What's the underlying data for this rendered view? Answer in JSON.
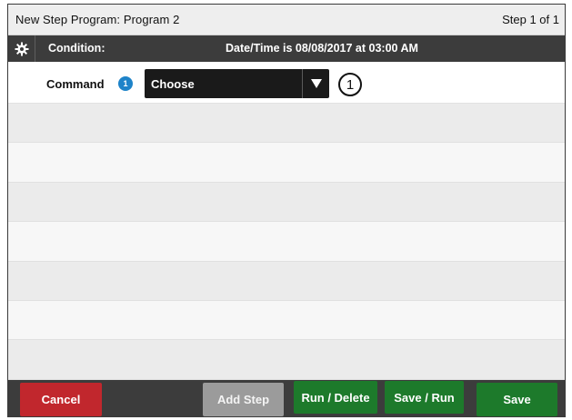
{
  "header": {
    "title": "New Step Program:  Program 2",
    "step": "Step 1 of 1"
  },
  "condition": {
    "label": "Condition:",
    "value": "Date/Time is 08/08/2017 at 03:00 AM",
    "icon": "gear-icon"
  },
  "command": {
    "label": "Command",
    "info_badge": "1",
    "select_value": "Choose",
    "callout": "1"
  },
  "footer": {
    "cancel": "Cancel",
    "add_step": "Add Step",
    "run_delete": "Run / Delete",
    "save_run": "Save / Run",
    "save": "Save"
  },
  "colors": {
    "cancel": "#c1272d",
    "action_green": "#1d7a2b",
    "disabled": "#9b9b9b",
    "info_blue": "#1e83c9",
    "bar": "#3c3c3c"
  }
}
